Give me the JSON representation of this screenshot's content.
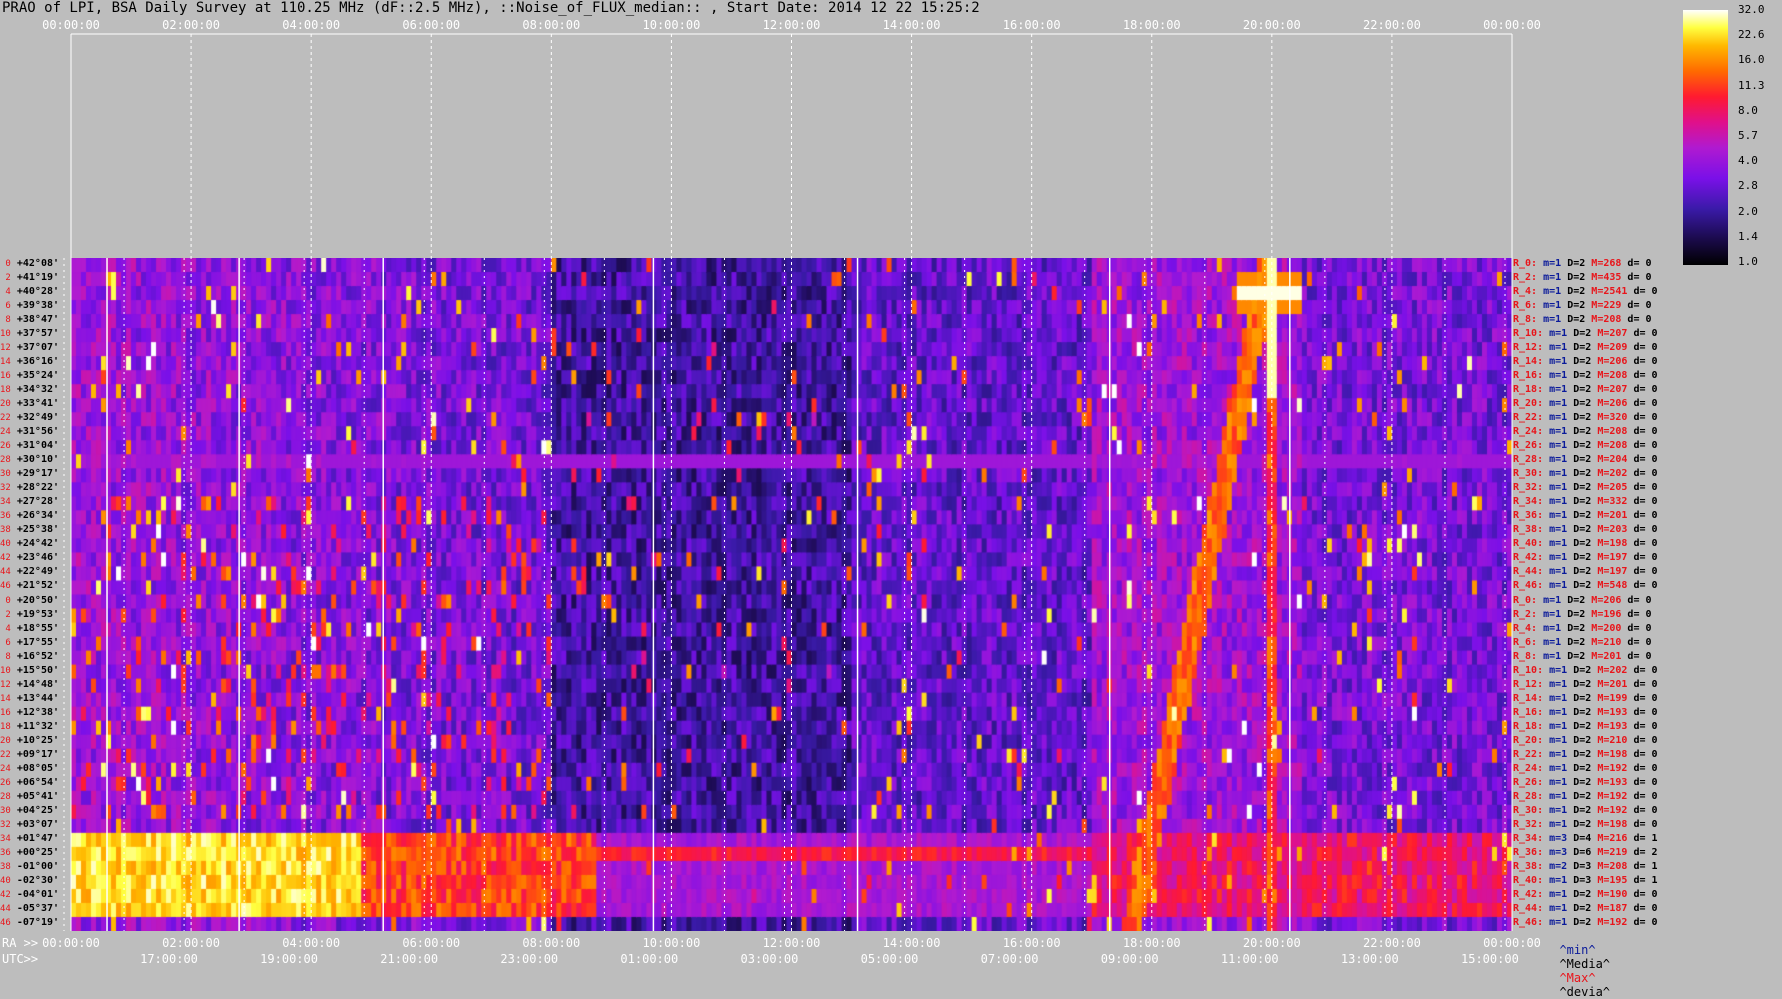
{
  "title": "PRAO of LPI, BSA Daily Survey at 110.25 MHz (dF::2.5 MHz), ::Noise_of_FLUX_median:: , Start Date: 2014 12 22 15:25:2",
  "axes": {
    "top_ticks": [
      "00:00:00",
      "02:00:00",
      "04:00:00",
      "06:00:00",
      "08:00:00",
      "10:00:00",
      "12:00:00",
      "14:00:00",
      "16:00:00",
      "18:00:00",
      "20:00:00",
      "22:00:00",
      "00:00:00"
    ],
    "ra_label": "RA >>",
    "ra_ticks": [
      "00:00:00",
      "02:00:00",
      "04:00:00",
      "06:00:00",
      "08:00:00",
      "10:00:00",
      "12:00:00",
      "14:00:00",
      "16:00:00",
      "18:00:00",
      "20:00:00",
      "22:00:00",
      "00:00:00"
    ],
    "utc_label": "UTC>>",
    "utc_ticks": [
      "17:00:00",
      "19:00:00",
      "21:00:00",
      "23:00:00",
      "01:00:00",
      "03:00:00",
      "05:00:00",
      "07:00:00",
      "09:00:00",
      "11:00:00",
      "13:00:00",
      "15:00:00"
    ]
  },
  "declinations": [
    "+42°08'",
    "+41°19'",
    "+40°28'",
    "+39°38'",
    "+38°47'",
    "+37°57'",
    "+37°07'",
    "+36°16'",
    "+35°24'",
    "+34°32'",
    "+33°41'",
    "+32°49'",
    "+31°56'",
    "+31°04'",
    "+30°10'",
    "+29°17'",
    "+28°22'",
    "+27°28'",
    "+26°34'",
    "+25°38'",
    "+24°42'",
    "+23°46'",
    "+22°49'",
    "+21°52'",
    "+20°50'",
    "+19°53'",
    "+18°55'",
    "+17°55'",
    "+16°52'",
    "+15°50'",
    "+14°48'",
    "+13°44'",
    "+12°38'",
    "+11°32'",
    "+10°25'",
    "+09°17'",
    "+08°05'",
    "+06°54'",
    "+05°41'",
    "+04°25'",
    "+03°07'",
    "+01°47'",
    "+00°25'",
    "-01°00'",
    "-02°30'",
    "-04°01'",
    "-05°37'",
    "-07°19'"
  ],
  "row_stats": [
    {
      "r": "R_0:",
      "m": "m=1",
      "d": "D=2",
      "mx": "M=268",
      "dv": "d= 0"
    },
    {
      "r": "R_2:",
      "m": "m=1",
      "d": "D=2",
      "mx": "M=435",
      "dv": "d= 0"
    },
    {
      "r": "R_4:",
      "m": "m=1",
      "d": "D=2",
      "mx": "M=2541",
      "dv": "d= 0"
    },
    {
      "r": "R_6:",
      "m": "m=1",
      "d": "D=2",
      "mx": "M=229",
      "dv": "d= 0"
    },
    {
      "r": "R_8:",
      "m": "m=1",
      "d": "D=2",
      "mx": "M=208",
      "dv": "d= 0"
    },
    {
      "r": "R_10:",
      "m": "m=1",
      "d": "D=2",
      "mx": "M=207",
      "dv": "d= 0"
    },
    {
      "r": "R_12:",
      "m": "m=1",
      "d": "D=2",
      "mx": "M=209",
      "dv": "d= 0"
    },
    {
      "r": "R_14:",
      "m": "m=1",
      "d": "D=2",
      "mx": "M=206",
      "dv": "d= 0"
    },
    {
      "r": "R_16:",
      "m": "m=1",
      "d": "D=2",
      "mx": "M=208",
      "dv": "d= 0"
    },
    {
      "r": "R_18:",
      "m": "m=1",
      "d": "D=2",
      "mx": "M=207",
      "dv": "d= 0"
    },
    {
      "r": "R_20:",
      "m": "m=1",
      "d": "D=2",
      "mx": "M=206",
      "dv": "d= 0"
    },
    {
      "r": "R_22:",
      "m": "m=1",
      "d": "D=2",
      "mx": "M=320",
      "dv": "d= 0"
    },
    {
      "r": "R_24:",
      "m": "m=1",
      "d": "D=2",
      "mx": "M=208",
      "dv": "d= 0"
    },
    {
      "r": "R_26:",
      "m": "m=1",
      "d": "D=2",
      "mx": "M=208",
      "dv": "d= 0"
    },
    {
      "r": "R_28:",
      "m": "m=1",
      "d": "D=2",
      "mx": "M=204",
      "dv": "d= 0"
    },
    {
      "r": "R_30:",
      "m": "m=1",
      "d": "D=2",
      "mx": "M=202",
      "dv": "d= 0"
    },
    {
      "r": "R_32:",
      "m": "m=1",
      "d": "D=2",
      "mx": "M=205",
      "dv": "d= 0"
    },
    {
      "r": "R_34:",
      "m": "m=1",
      "d": "D=2",
      "mx": "M=332",
      "dv": "d= 0"
    },
    {
      "r": "R_36:",
      "m": "m=1",
      "d": "D=2",
      "mx": "M=201",
      "dv": "d= 0"
    },
    {
      "r": "R_38:",
      "m": "m=1",
      "d": "D=2",
      "mx": "M=203",
      "dv": "d= 0"
    },
    {
      "r": "R_40:",
      "m": "m=1",
      "d": "D=2",
      "mx": "M=198",
      "dv": "d= 0"
    },
    {
      "r": "R_42:",
      "m": "m=1",
      "d": "D=2",
      "mx": "M=197",
      "dv": "d= 0"
    },
    {
      "r": "R_44:",
      "m": "m=1",
      "d": "D=2",
      "mx": "M=197",
      "dv": "d= 0"
    },
    {
      "r": "R_46:",
      "m": "m=1",
      "d": "D=2",
      "mx": "M=548",
      "dv": "d= 0"
    },
    {
      "r": "R_0:",
      "m": "m=1",
      "d": "D=2",
      "mx": "M=206",
      "dv": "d= 0"
    },
    {
      "r": "R_2:",
      "m": "m=1",
      "d": "D=2",
      "mx": "M=196",
      "dv": "d= 0"
    },
    {
      "r": "R_4:",
      "m": "m=1",
      "d": "D=2",
      "mx": "M=200",
      "dv": "d= 0"
    },
    {
      "r": "R_6:",
      "m": "m=1",
      "d": "D=2",
      "mx": "M=210",
      "dv": "d= 0"
    },
    {
      "r": "R_8:",
      "m": "m=1",
      "d": "D=2",
      "mx": "M=201",
      "dv": "d= 0"
    },
    {
      "r": "R_10:",
      "m": "m=1",
      "d": "D=2",
      "mx": "M=202",
      "dv": "d= 0"
    },
    {
      "r": "R_12:",
      "m": "m=1",
      "d": "D=2",
      "mx": "M=201",
      "dv": "d= 0"
    },
    {
      "r": "R_14:",
      "m": "m=1",
      "d": "D=2",
      "mx": "M=199",
      "dv": "d= 0"
    },
    {
      "r": "R_16:",
      "m": "m=1",
      "d": "D=2",
      "mx": "M=193",
      "dv": "d= 0"
    },
    {
      "r": "R_18:",
      "m": "m=1",
      "d": "D=2",
      "mx": "M=193",
      "dv": "d= 0"
    },
    {
      "r": "R_20:",
      "m": "m=1",
      "d": "D=2",
      "mx": "M=210",
      "dv": "d= 0"
    },
    {
      "r": "R_22:",
      "m": "m=1",
      "d": "D=2",
      "mx": "M=198",
      "dv": "d= 0"
    },
    {
      "r": "R_24:",
      "m": "m=1",
      "d": "D=2",
      "mx": "M=192",
      "dv": "d= 0"
    },
    {
      "r": "R_26:",
      "m": "m=1",
      "d": "D=2",
      "mx": "M=193",
      "dv": "d= 0"
    },
    {
      "r": "R_28:",
      "m": "m=1",
      "d": "D=2",
      "mx": "M=192",
      "dv": "d= 0"
    },
    {
      "r": "R_30:",
      "m": "m=1",
      "d": "D=2",
      "mx": "M=192",
      "dv": "d= 0"
    },
    {
      "r": "R_32:",
      "m": "m=1",
      "d": "D=2",
      "mx": "M=198",
      "dv": "d= 0"
    },
    {
      "r": "R_34:",
      "m": "m=3",
      "d": "D=4",
      "mx": "M=216",
      "dv": "d= 1"
    },
    {
      "r": "R_36:",
      "m": "m=3",
      "d": "D=6",
      "mx": "M=219",
      "dv": "d= 2"
    },
    {
      "r": "R_38:",
      "m": "m=2",
      "d": "D=3",
      "mx": "M=208",
      "dv": "d= 1"
    },
    {
      "r": "R_40:",
      "m": "m=1",
      "d": "D=3",
      "mx": "M=195",
      "dv": "d= 1"
    },
    {
      "r": "R_42:",
      "m": "m=1",
      "d": "D=2",
      "mx": "M=190",
      "dv": "d= 0"
    },
    {
      "r": "R_44:",
      "m": "m=1",
      "d": "D=2",
      "mx": "M=187",
      "dv": "d= 0"
    },
    {
      "r": "R_46:",
      "m": "m=1",
      "d": "D=2",
      "mx": "M=192",
      "dv": "d= 0"
    }
  ],
  "legend": {
    "min": "^min^",
    "media": "^Media^",
    "max": "^Max^",
    "devia": "^devia^",
    "min_color": "#0a1a9a",
    "media_color": "#000000",
    "max_color": "#e8151b",
    "devia_color": "#000000"
  },
  "colorbar_ticks": [
    "32.0",
    "22.6",
    "16.0",
    "11.3",
    "8.0",
    "5.7",
    "4.0",
    "2.8",
    "2.0",
    "1.4",
    "1.0"
  ],
  "chart_data": {
    "type": "heatmap",
    "title": "PRAO of LPI, BSA Daily Survey at 110.25 MHz (dF::2.5 MHz), ::Noise_of_FLUX_median:: , Start Date: 2014 12 22 15:25:2",
    "x_axis": "RA 00:00:00 to 24:00:00 (UTC 15:25 to 15:25 next day)",
    "y_axis": "Declination +42°08' to -07°19' (48 beams)",
    "color_scale": [
      1.0,
      32.0
    ],
    "features": [
      {
        "kind": "bright-source",
        "ra_hours": 19.95,
        "dec": "+40°28'",
        "value": 32.0
      },
      {
        "kind": "strong-band",
        "dec_range": [
          "+01°47'",
          "-05°37'"
        ],
        "ra_range_hours": [
          0.0,
          4.8
        ],
        "value": 22.6
      },
      {
        "kind": "drift-track",
        "ra_start_hours": 17.6,
        "ra_end_hours": 19.9,
        "value": 8.0
      },
      {
        "kind": "quiet-region",
        "ra_range_hours": [
          8.0,
          13.0
        ],
        "value": 1.4
      }
    ]
  }
}
